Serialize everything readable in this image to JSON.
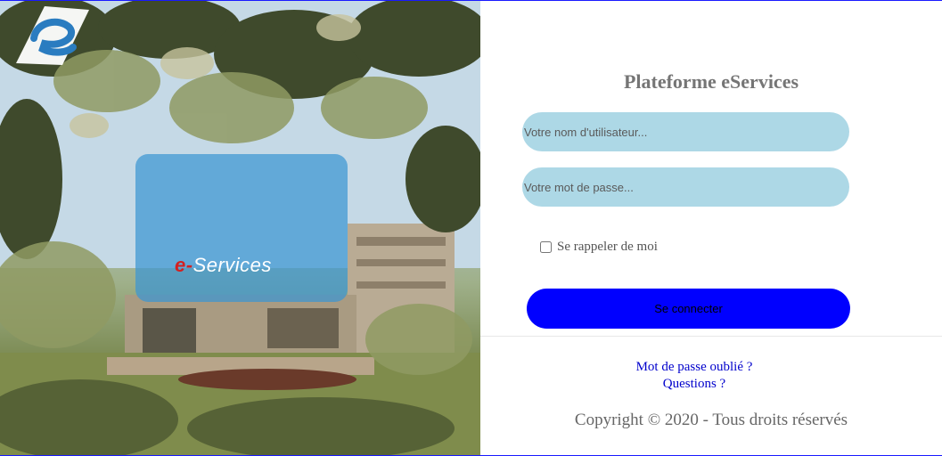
{
  "login": {
    "title": "Plateforme eServices",
    "username_placeholder": "Votre nom d'utilisateur...",
    "password_placeholder": "Votre mot de passe...",
    "remember_label": "Se rappeler de moi",
    "submit_label": "Se connecter"
  },
  "links": {
    "forgot_password": "Mot de passe oublié ?",
    "questions": "Questions ?"
  },
  "footer": {
    "copyright": "Copyright © 2020 - Tous droits réservés"
  },
  "logo": {
    "prefix": "e-",
    "text": "Services"
  },
  "colors": {
    "input_bg": "#add8e6",
    "button_bg": "#0000ff",
    "title": "#757575",
    "link": "#0000cc"
  }
}
